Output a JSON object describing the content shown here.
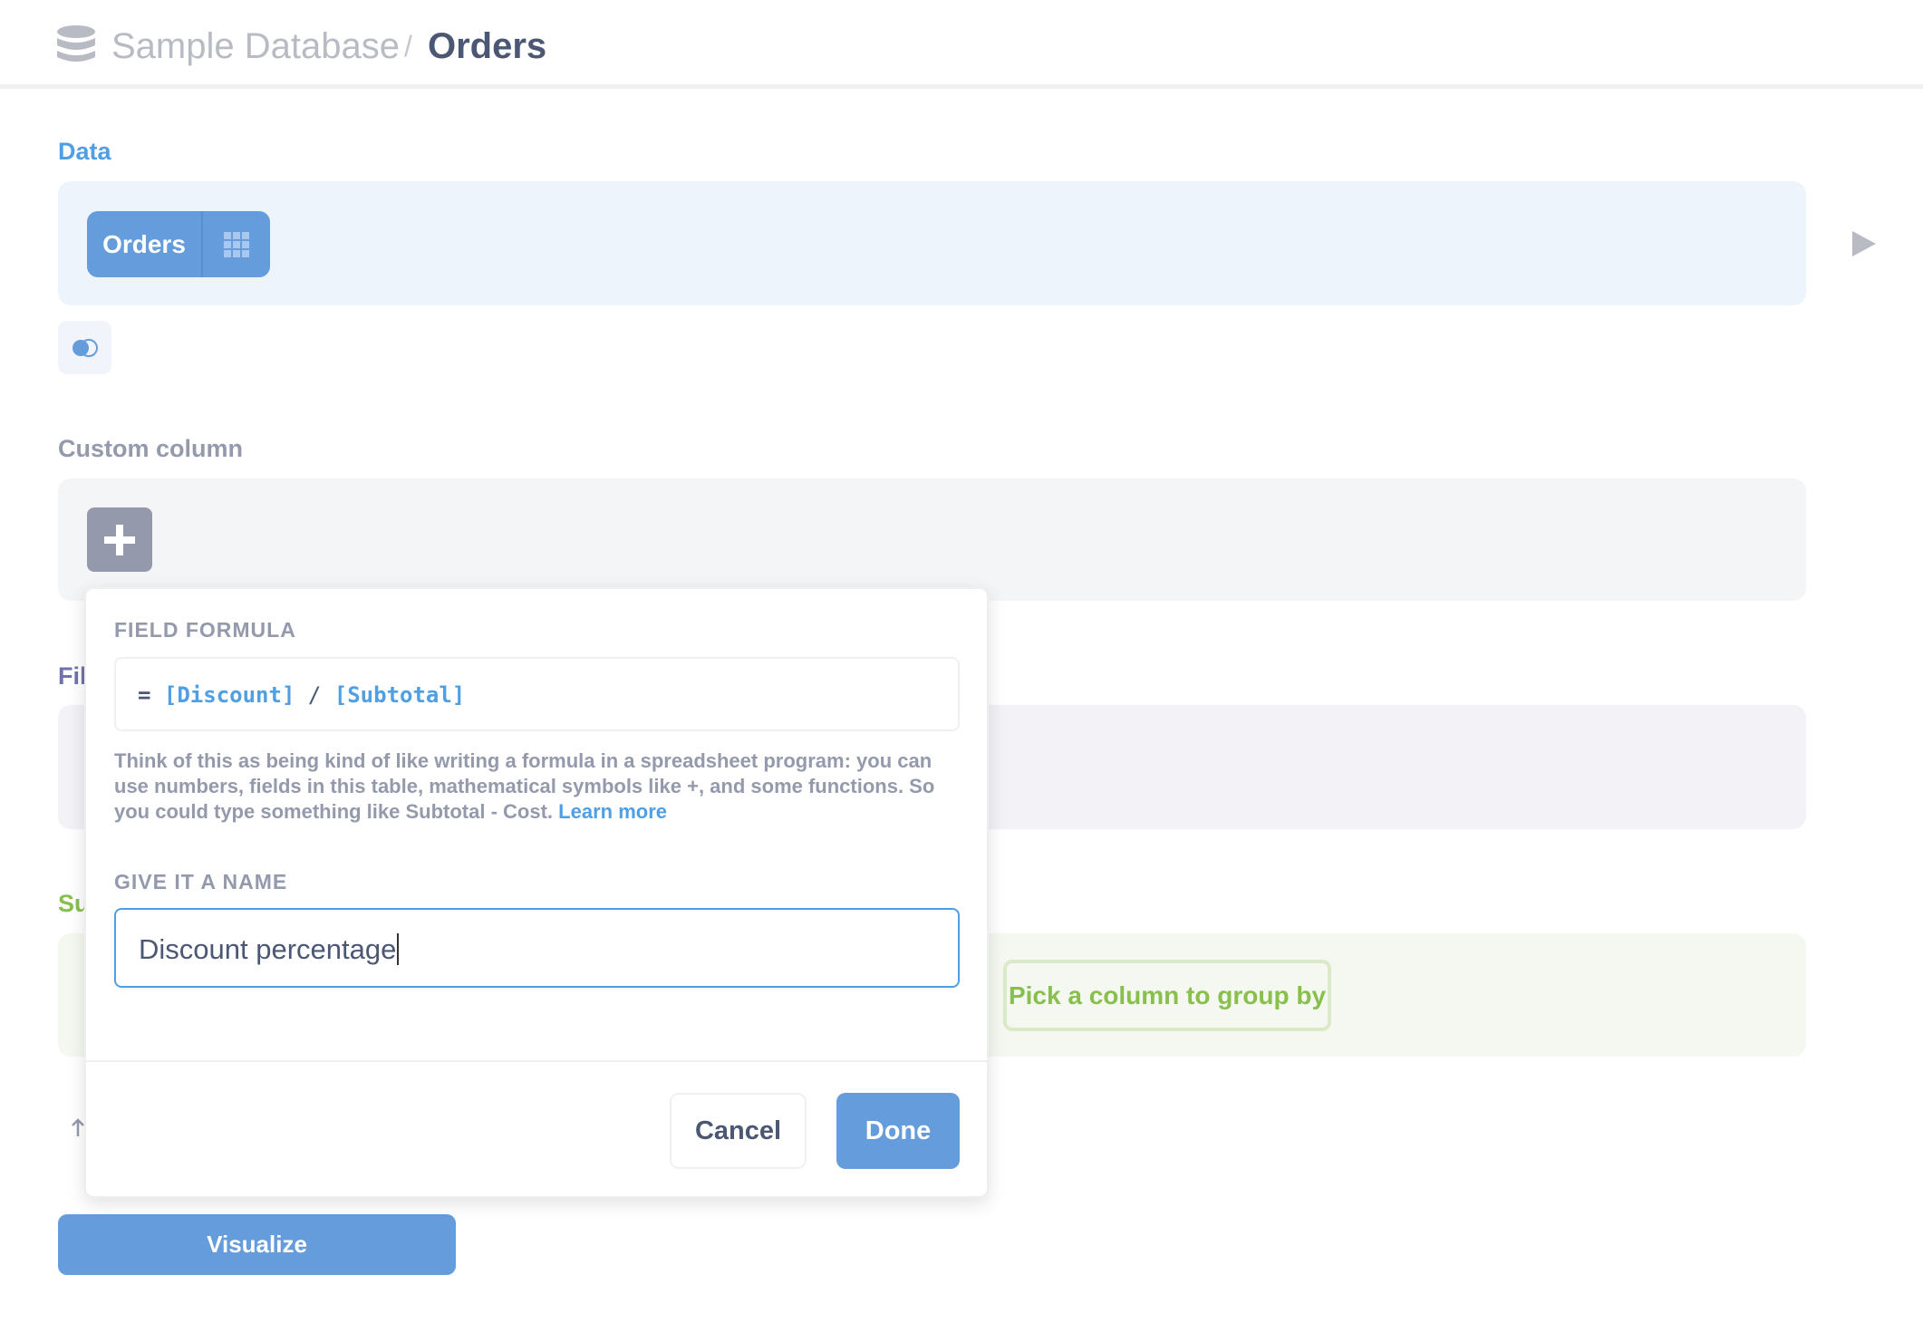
{
  "header": {
    "database": "Sample Database",
    "separator": "/",
    "table": "Orders",
    "icon": "database-icon"
  },
  "data_section": {
    "label": "Data",
    "table_button": "Orders",
    "table_icon": "grid-icon",
    "join_icon": "join-icon",
    "run_icon": "play-icon"
  },
  "custom_column": {
    "label": "Custom column",
    "add_icon": "plus-icon"
  },
  "filter": {
    "label": "Fil"
  },
  "summarize": {
    "label": "Su",
    "group_by": "Pick a column to group by"
  },
  "sort_icon": "arrow-up-icon",
  "visualize": "Visualize",
  "popover": {
    "formula_label": "FIELD FORMULA",
    "formula": {
      "equals": "=",
      "field1": "[Discount]",
      "op": "/",
      "field2": "[Subtotal]"
    },
    "help": "Think of this as being kind of like writing a formula in a spreadsheet program: you can use numbers, fields in this table, mathematical symbols like +, and some functions. So you could type something like Subtotal - Cost.",
    "learn_more": "Learn more",
    "name_label": "GIVE IT A NAME",
    "name_value": "Discount percentage",
    "cancel": "Cancel",
    "done": "Done"
  },
  "colors": {
    "brand": "#509ee3",
    "button": "#659cdc",
    "filter": "#7172ad",
    "summarize": "#88bf4d"
  }
}
